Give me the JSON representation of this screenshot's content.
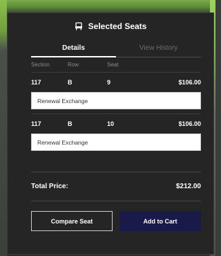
{
  "header": {
    "title": "Selected Seats",
    "icon": "seat-icon"
  },
  "tabs": [
    {
      "label": "Details",
      "active": true
    },
    {
      "label": "View History",
      "active": false
    }
  ],
  "columns": {
    "section": "Section",
    "row": "Row",
    "seat": "Seat"
  },
  "seats": [
    {
      "section": "117",
      "row": "B",
      "seat": "9",
      "price": "$106.00",
      "note": "Renewal Exchange"
    },
    {
      "section": "117",
      "row": "B",
      "seat": "10",
      "price": "$106.00",
      "note": "Renewal Exchange"
    }
  ],
  "total": {
    "label": "Total Price:",
    "amount": "$212.00"
  },
  "buttons": {
    "compare": "Compare Seat",
    "add_to_cart": "Add to Cart"
  },
  "colors": {
    "panel": "#242524",
    "primary_button": "#1a1a4a",
    "text": "#ffffff"
  }
}
